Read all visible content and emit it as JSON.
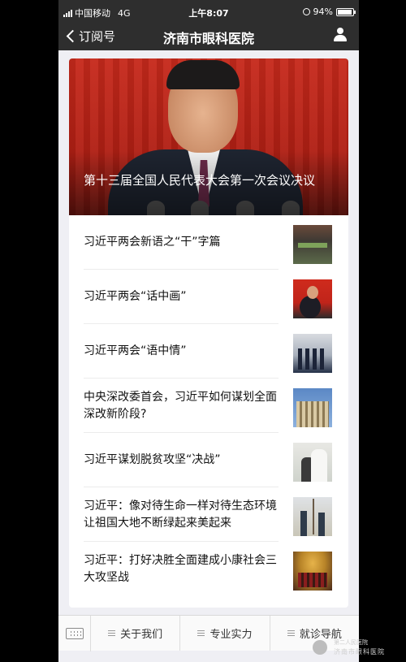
{
  "status": {
    "carrier": "中国移动",
    "network": "4G",
    "time": "上午8:07",
    "battery_text": "94%",
    "battery_level": 0.94
  },
  "nav": {
    "back_label": "订阅号",
    "title": "济南市眼科医院"
  },
  "hero": {
    "title": "第十三届全国人民代表大会第一次会议决议"
  },
  "articles": [
    {
      "title": "习近平两会新语之“干”字篇"
    },
    {
      "title": "习近平两会“话中画”"
    },
    {
      "title": "习近平两会“语中情”"
    },
    {
      "title": "中央深改委首会，习近平如何谋划全面深改新阶段?"
    },
    {
      "title": "习近平谋划脱贫攻坚“决战”"
    },
    {
      "title": "习近平：像对待生命一样对待生态环境 让祖国大地不断绿起来美起来"
    },
    {
      "title": "习近平：打好决胜全面建成小康社会三大攻坚战"
    }
  ],
  "bottom_menu": {
    "items": [
      "关于我们",
      "专业实力",
      "就诊导航"
    ]
  },
  "watermark": {
    "line1": "第二人民医院",
    "line2": "济南市眼科医院"
  },
  "colors": {
    "nav_bg": "#2e2e2e",
    "hero_red": "#c72a1c",
    "page_bg": "#efeff4"
  }
}
